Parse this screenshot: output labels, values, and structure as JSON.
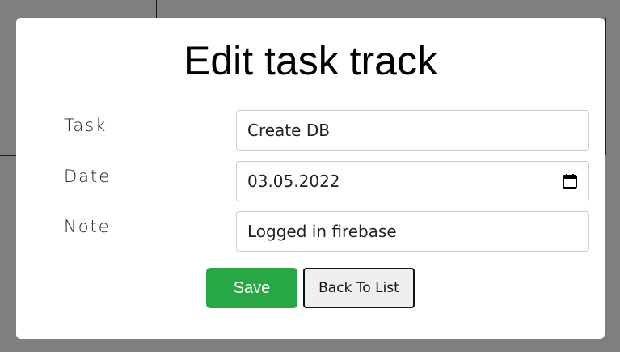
{
  "modal": {
    "title": "Edit task track"
  },
  "form": {
    "task": {
      "label": "Task",
      "value": "Create DB"
    },
    "date": {
      "label": "Date",
      "value": "03.05.2022",
      "icon": "calendar-icon"
    },
    "note": {
      "label": "Note",
      "value": "Logged in firebase"
    }
  },
  "actions": {
    "save_label": "Save",
    "back_label": "Back To List"
  },
  "colors": {
    "overlay": "#7f7f7f",
    "save_button": "#28a745",
    "back_button_bg": "#efefef"
  }
}
